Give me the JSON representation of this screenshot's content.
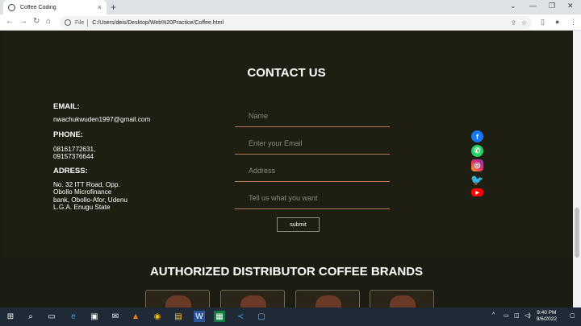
{
  "browser": {
    "tab_title": "Coffee Coding",
    "tab_close": "×",
    "new_tab": "+",
    "file_label": "File",
    "url": "C:/Users/deis/Desktop/Web%20Practice/Coffee.html",
    "min": "⌄",
    "restore": "—",
    "maximize": "❐",
    "close": "✕"
  },
  "contact": {
    "title": "CONTACT US",
    "email_label": "EMAIL:",
    "email_value": "nwachukwuden1997@gmail.com",
    "phone_label": "PHONE:",
    "phone_line1": "08161772631,",
    "phone_line2": "09157376644",
    "address_label": "ADRESS:",
    "address_line1": "No. 32 ITT Road, Opp.",
    "address_line2": "Obollo Microfinance",
    "address_line3": "bank, Obollo-Afor, Udenu",
    "address_line4": "L.G.A. Enugu State"
  },
  "form": {
    "name_placeholder": "Name",
    "email_placeholder": "Enter your Email",
    "address_placeholder": "Address",
    "message_placeholder": "Tell us what you want",
    "submit_label": "submit"
  },
  "social": [
    "facebook-icon",
    "whatsapp-icon",
    "instagram-icon",
    "twitter-icon",
    "youtube-icon"
  ],
  "brands": {
    "title": "AUTHORIZED DISTRIBUTOR COFFEE BRANDS"
  },
  "taskbar": {
    "time": "9:40 PM",
    "date": "9/6/2022"
  }
}
